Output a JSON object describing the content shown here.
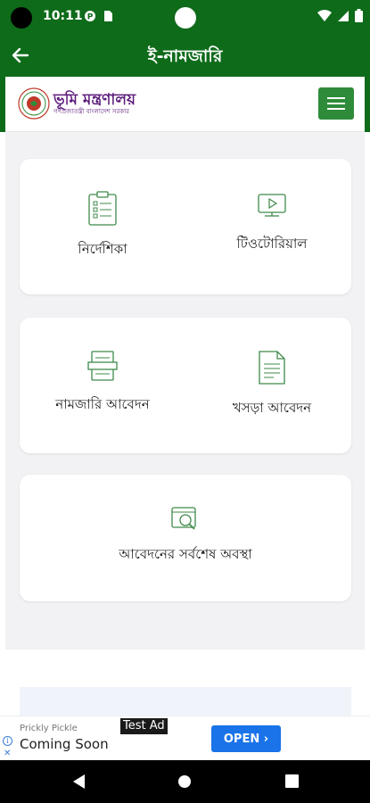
{
  "status_bar": {
    "time": "10:11",
    "colors": {
      "background": "#0e6b1a"
    }
  },
  "app_bar": {
    "title": "ই-নামজারি"
  },
  "header": {
    "logo_title": "ভূমি মন্ত্রণালয়",
    "logo_subtitle": "গণপ্রজাতন্ত্রী বাংলাদেশ সরকার"
  },
  "cards": [
    {
      "tiles": [
        {
          "label": "নির্দেশিকা",
          "icon": "clipboard-list-icon"
        },
        {
          "label": "টিওটোরিয়াল",
          "icon": "video-tutorial-icon"
        }
      ]
    },
    {
      "tiles": [
        {
          "label": "নামজারি আবেদন",
          "icon": "document-form-icon"
        },
        {
          "label": "খসড়া আবেদন",
          "icon": "draft-document-icon"
        }
      ]
    },
    {
      "tiles": [
        {
          "label": "আবেদনের সর্বশেষ অবস্থা",
          "icon": "application-status-search-icon"
        }
      ]
    }
  ],
  "ad": {
    "brand": "Prickly Pickle",
    "title": "Coming Soon",
    "tag": "Test Ad",
    "cta": "OPEN ›",
    "colors": {
      "cta": "#1a73e8"
    }
  },
  "colors": {
    "primary": "#0e6b1a",
    "menu_button": "#2e8b3a",
    "icon_stroke": "#3f8a4a",
    "logo_text": "#5b1b7a"
  }
}
